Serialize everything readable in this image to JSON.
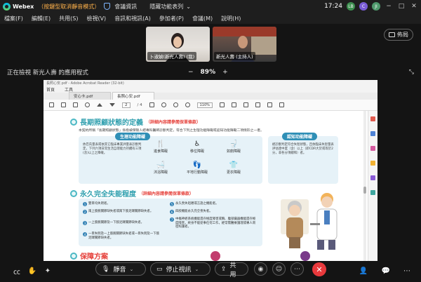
{
  "titlebar": {
    "app_name": "Webex",
    "mute_notice": "（按鍵型取消靜音模式）",
    "meeting_info": "會議資訊",
    "hide_menu": "隱藏功能表列",
    "time": "17:24",
    "avatars": [
      {
        "text": "LB",
        "color": "#3d8f4f"
      },
      {
        "text": "C",
        "color": "#7a5cd6"
      },
      {
        "text": "JI",
        "color": "#4f9a6d"
      }
    ]
  },
  "menubar": [
    "檔案(F)",
    "編輯(E)",
    "共用(S)",
    "檢視(V)",
    "音訊和視訊(A)",
    "參加者(P)",
    "會議(M)",
    "說明(H)"
  ],
  "participants": [
    {
      "label": "卜淑媜(新光人壽) (我)"
    },
    {
      "label": "新光人壽 (主持人)"
    }
  ],
  "layout_button": "佈局",
  "sharebar": {
    "viewing_text": "正在檢視 新光人壽 的應用程式",
    "zoom_minus": "−",
    "zoom_value": "89%",
    "zoom_plus": "+"
  },
  "acrobat": {
    "title": "長照心安.pdf - Adobe Acrobat Reader (32-bit)",
    "menu": [
      "首頁",
      "工具"
    ],
    "tabs": [
      "安心卡.pdf",
      "長照心安.pdf"
    ],
    "page_current": "2",
    "page_total": "/ 4",
    "zoom": "110%"
  },
  "document": {
    "heading1": "長期照顧狀態的定義",
    "heading1_note": "（詳細內容請參閱保單條款）",
    "intro": "本契約所稱「長期照顧狀態」係指被保險人經專科醫師診斷判定，符合下列之生理功能障礙或認知功能障礙二項情形之一者。",
    "physical": {
      "title": "生理功能障礙",
      "desc": "依巴氏量表或依其它臨床專業評量表診斷判定，下列六項日常生活自理能力持續有三項(含)以上之障礙。",
      "items": [
        {
          "icon": "dining-icon",
          "glyph": "🍴",
          "label": "進食障礙"
        },
        {
          "icon": "transfer-icon",
          "glyph": "♿",
          "label": "移位障礙"
        },
        {
          "icon": "toilet-icon",
          "glyph": "🚽",
          "label": "如廁障礙"
        },
        {
          "icon": "bath-icon",
          "glyph": "🛁",
          "label": "沐浴障礙"
        },
        {
          "icon": "walking-icon",
          "glyph": "👣",
          "label": "平地行動障礙"
        },
        {
          "icon": "dressing-icon",
          "glyph": "👕",
          "label": "更衣障礙"
        }
      ]
    },
    "cognitive": {
      "title": "認知功能障礙",
      "desc": "經診斷判定符合失智狀態，且依臨床失智量表評估達中度（含）以上（即CDR大於或等於2分，非各分項總和）者。"
    },
    "heading2": "永久完全失能程度",
    "heading2_note": "（詳細內容請參閱保單條款）",
    "disability_items": [
      {
        "n": "1",
        "text": "雙目均失明者。"
      },
      {
        "n": "2",
        "text": "兩上肢腕關節缺失者或兩下肢足踝關節缺失者。"
      },
      {
        "n": "3",
        "text": "一上肢腕關節及一下肢足踝關節缺失者。"
      },
      {
        "n": "4",
        "text": "一目失明及一上肢腕關節缺失者或一目失明及一下肢足踝關節缺失者。"
      },
      {
        "n": "5",
        "text": "永久喪失咀嚼或言語之機能者。"
      },
      {
        "n": "6",
        "text": "四肢機能永久完全喪失者。"
      },
      {
        "n": "7",
        "text": "中樞神經系統機能遺存極度障害或胸、腹部臟器機能遺存極度障害，終身不能從事任何工作，經常需醫療護理或專人周密照護者。"
      }
    ],
    "heading3": "保障方案"
  },
  "bottombar": {
    "mute_label": "靜音",
    "video_label": "停止視訊",
    "share_label": "共用"
  },
  "colors": {
    "accent_teal": "#2f9fae",
    "note_red": "#e6433d",
    "pill_blue": "#2f8fb6",
    "end_call_red": "#e8393c"
  }
}
